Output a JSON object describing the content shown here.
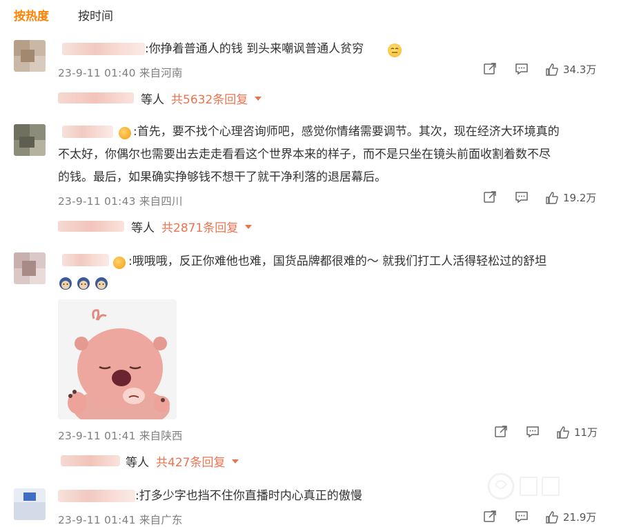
{
  "tabs": {
    "hot": "按热度",
    "time": "按时间"
  },
  "comments": [
    {
      "text": ":你挣着普通人的钱 到头来嘲讽普通人贫穷",
      "meta": "23-9-11 01:40 来自河南",
      "likes": "34.3万",
      "reply_deng": "等人",
      "reply_count": "共5632条回复"
    },
    {
      "text_lines": [
        ":首先，要不找个心理咨询师吧，感觉你情绪需要调节。其次，现在经济大环境真的",
        "不太好，你偶尔也需要出去走走看看这个世界本来的样子，而不是只坐在镜头前面收割着数不尽",
        "的钱。最后，如果确实挣够钱不想干了就干净利落的退居幕后。"
      ],
      "meta": "23-9-11 01:43 来自四川",
      "likes": "19.2万",
      "reply_deng": "等人",
      "reply_count": "共2871条回复"
    },
    {
      "text": ":哦哦哦，反正你难他也难，国货品牌都很难的～ 就我们打工人活得轻松过的舒坦",
      "meta": "23-9-11 01:41 来自陕西",
      "likes": "11万",
      "reply_deng": "等人",
      "reply_count": "共427条回复"
    },
    {
      "text": ":打多少字也挡不住你直播时内心真正的傲慢",
      "meta": "23-9-11 01:41 来自广东",
      "likes": "21.9万"
    }
  ],
  "icons": {
    "share": "share-icon",
    "comment": "comment-icon",
    "like": "thumbs-up-icon"
  },
  "colors": {
    "accent": "#ff8200",
    "reply_link": "#eb7350",
    "meta_gray": "#808080"
  }
}
